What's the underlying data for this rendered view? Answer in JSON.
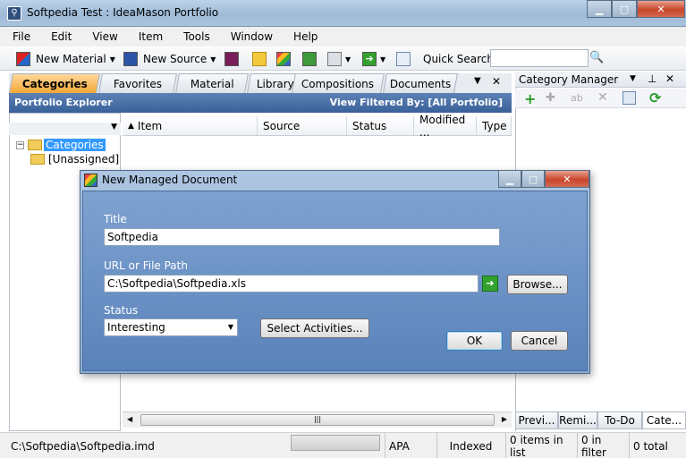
{
  "window": {
    "title": "Softpedia Test : IdeaMason Portfolio",
    "app_icon": "app-icon"
  },
  "menu": [
    "File",
    "Edit",
    "View",
    "Item",
    "Tools",
    "Window",
    "Help"
  ],
  "toolbar": {
    "new_material": "New Material",
    "new_source": "New Source",
    "quick_search_label": "Quick Search",
    "quick_search_value": ""
  },
  "tabs": [
    {
      "label": "Categories",
      "active": true
    },
    {
      "label": "Favorites",
      "active": false
    },
    {
      "label": "Material",
      "active": false
    },
    {
      "label": "Library",
      "active": false
    },
    {
      "label": "Compositions",
      "active": false
    },
    {
      "label": "Documents",
      "active": false
    }
  ],
  "portfolio": {
    "title": "Portfolio Explorer",
    "filter": "View Filtered By: [All Portfolio]"
  },
  "tree": [
    {
      "label": "Categories",
      "selected": true
    },
    {
      "label": "[Unassigned]",
      "selected": false
    }
  ],
  "grid": {
    "columns": [
      "Item",
      "Source",
      "Status",
      "Modified ...",
      "Type"
    ]
  },
  "category_manager": {
    "title": "Category Manager",
    "tabs": [
      "Previ...",
      "Remi...",
      "To-Do",
      "Cate..."
    ]
  },
  "status": {
    "path": "C:\\Softpedia\\Softpedia.imd",
    "style": "APA",
    "indexed": "Indexed",
    "in_list": "0 items in list",
    "in_filter": "0 in filter",
    "total": "0 total"
  },
  "dialog": {
    "title": "New Managed Document",
    "title_label": "Title",
    "title_value": "Softpedia",
    "url_label": "URL or File Path",
    "url_value": "C:\\Softpedia\\Softpedia.xls",
    "browse": "Browse...",
    "status_label": "Status",
    "status_value": "Interesting",
    "select_activities": "Select Activities...",
    "ok": "OK",
    "cancel": "Cancel"
  },
  "colors": {
    "accent_tab": "#f4a835",
    "header_blue": "#3a609a",
    "dialog_body": "#6d93c6"
  }
}
